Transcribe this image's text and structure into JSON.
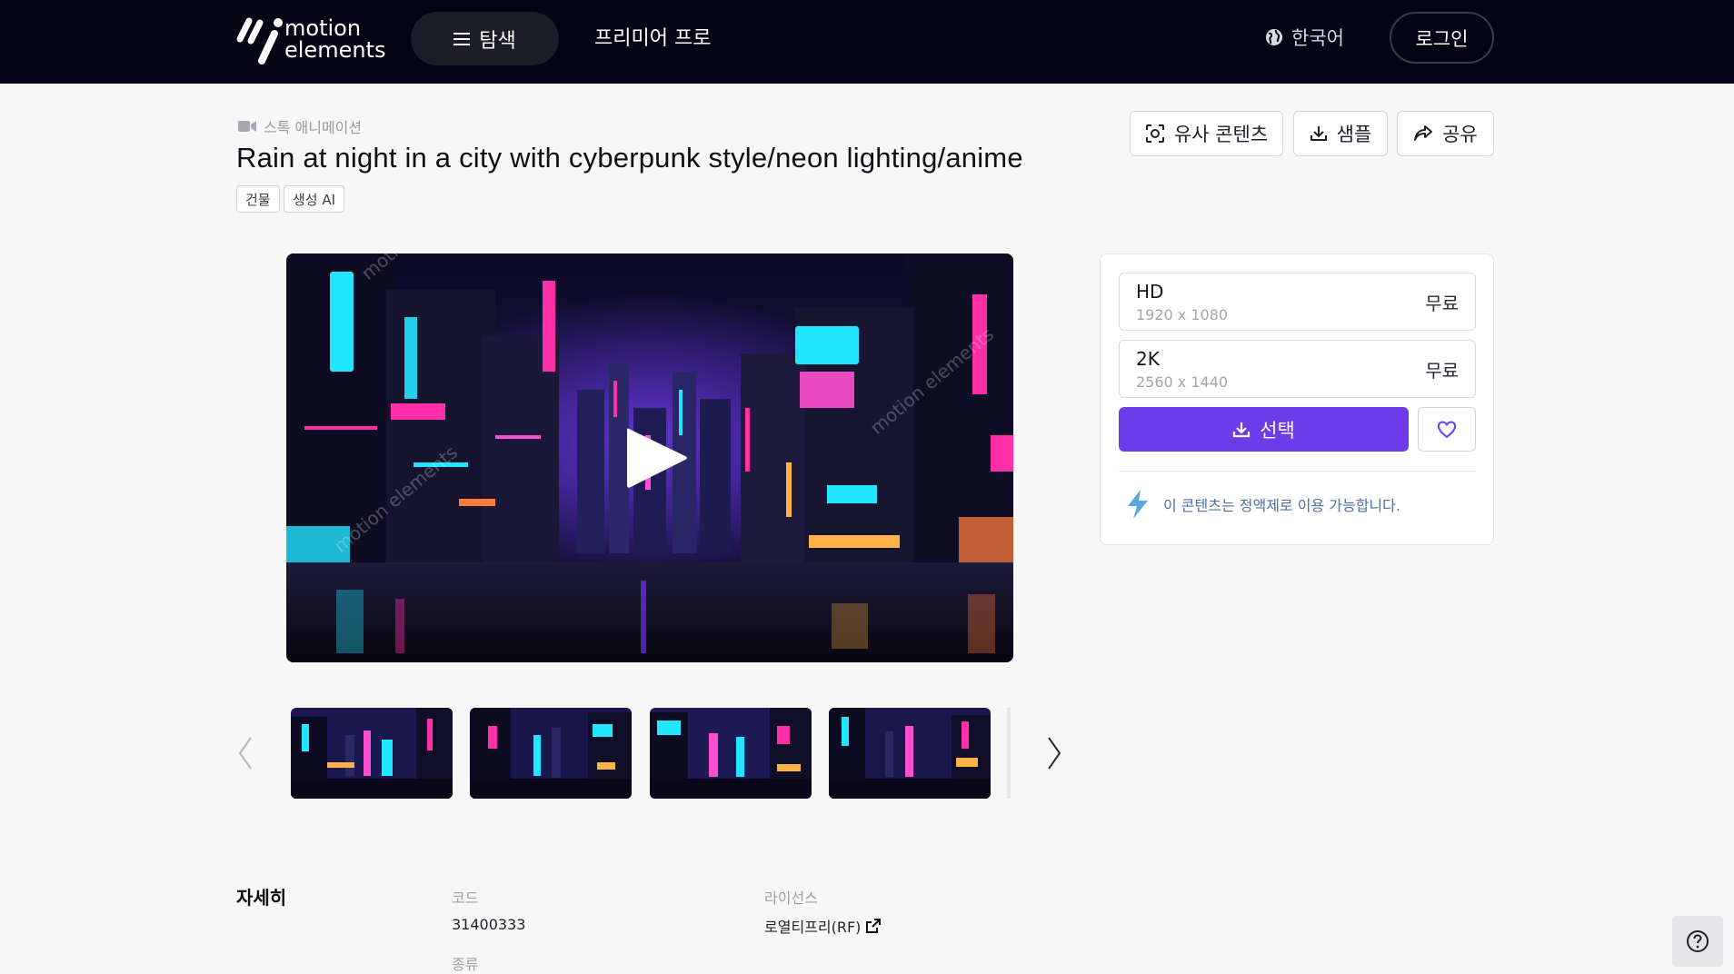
{
  "header": {
    "logo_line1": "motion",
    "logo_line2": "elements",
    "explore_label": "탐색",
    "premium_label": "프리미어 프로",
    "language_label": "한국어",
    "login_label": "로그인"
  },
  "breadcrumb": {
    "category": "스톡 애니메이션"
  },
  "title": "Rain at night in a city with cyberpunk style/neon lighting/anime",
  "tags": [
    "건물",
    "생성 AI"
  ],
  "actions": {
    "similar_label": "유사 콘텐츠",
    "sample_label": "샘플",
    "share_label": "공유"
  },
  "options": [
    {
      "name": "HD",
      "resolution": "1920 x 1080",
      "price": "무료"
    },
    {
      "name": "2K",
      "resolution": "2560 x 1440",
      "price": "무료"
    }
  ],
  "select_label": "선택",
  "plan_note": "이 콘텐츠는 정액제로 이용 가능합니다.",
  "details": {
    "heading": "자세히",
    "code_label": "코드",
    "code_value": "31400333",
    "license_label": "라이선스",
    "license_value": "로열티프리(RF)",
    "type_label": "종류"
  },
  "colors": {
    "header_bg": "#050414",
    "accent": "#6c3ce8",
    "neon_pink": "#ff2fa8",
    "neon_cyan": "#21e6ff"
  }
}
